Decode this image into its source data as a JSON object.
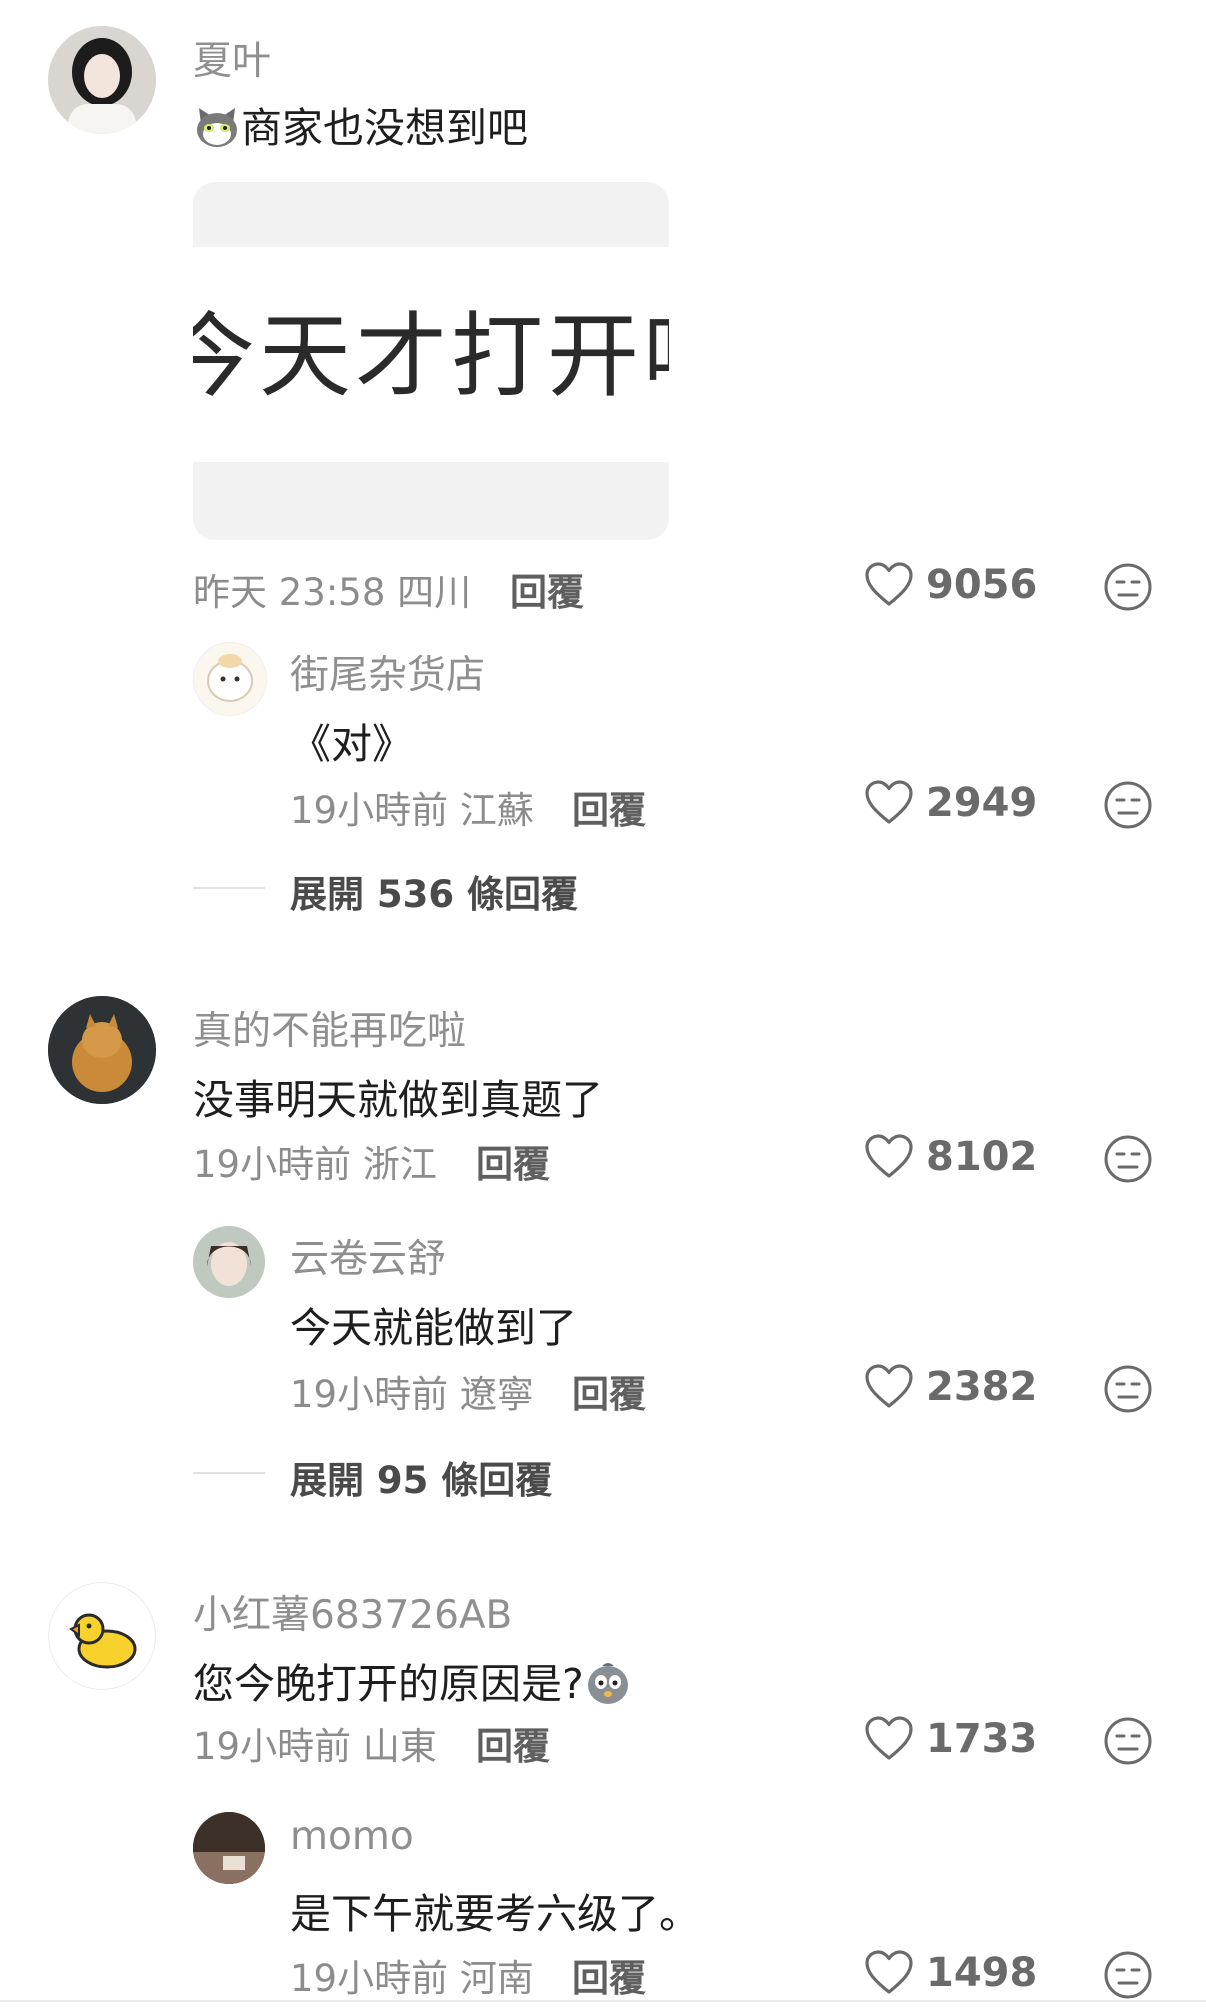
{
  "colors": {
    "background": "#ffffff",
    "username": "#8f8f8f",
    "meta": "#8c8c8c",
    "text": "#1e1e1e"
  },
  "comments": [
    {
      "username": "夏叶",
      "text": "商家也没想到吧",
      "image_text": "今天才打开吗",
      "time": "昨天 23:58",
      "location": "四川",
      "reply_label": "回覆",
      "likes": "9056",
      "replies": [
        {
          "username": "街尾杂货店",
          "text": "《对》",
          "time": "19小時前",
          "location": "江蘇",
          "reply_label": "回覆",
          "likes": "2949"
        }
      ],
      "expand": "展開 536 條回覆"
    },
    {
      "username": "真的不能再吃啦",
      "text": "没事明天就做到真题了",
      "time": "19小時前",
      "location": "浙江",
      "reply_label": "回覆",
      "likes": "8102",
      "replies": [
        {
          "username": "云卷云舒",
          "text": "今天就能做到了",
          "time": "19小時前",
          "location": "遼寧",
          "reply_label": "回覆",
          "likes": "2382"
        }
      ],
      "expand": "展開 95 條回覆"
    },
    {
      "username": "小红薯683726AB",
      "text": "您今晚打开的原因是?",
      "time": "19小時前",
      "location": "山東",
      "reply_label": "回覆",
      "likes": "1733",
      "replies": [
        {
          "username": "momo",
          "text": "是下午就要考六级了。",
          "time": "19小時前",
          "location": "河南",
          "reply_label": "回覆",
          "likes": "1498"
        }
      ]
    }
  ],
  "icons": {
    "like": "heart-outline-icon",
    "dislike": "meh-face-icon"
  }
}
